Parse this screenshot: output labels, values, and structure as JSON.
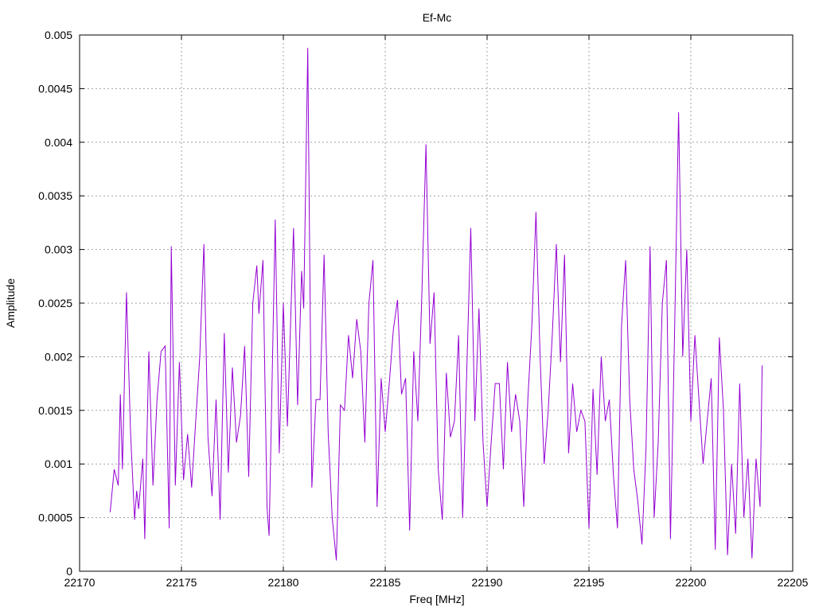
{
  "chart_data": {
    "type": "line",
    "title": "Ef-Mc",
    "xlabel": "Freq [MHz]",
    "ylabel": "Amplitude",
    "xlim": [
      22170,
      22205
    ],
    "ylim": [
      0,
      0.005
    ],
    "grid": true,
    "xticks": [
      22170,
      22175,
      22180,
      22185,
      22190,
      22195,
      22200,
      22205
    ],
    "xtick_labels": [
      "22170",
      "22175",
      "22180",
      "22185",
      "22190",
      "22195",
      "22200",
      "22205"
    ],
    "yticks": [
      0,
      0.0005,
      0.001,
      0.0015,
      0.002,
      0.0025,
      0.003,
      0.0035,
      0.004,
      0.0045,
      0.005
    ],
    "ytick_labels": [
      "0",
      "0.0005",
      "0.001",
      "0.0015",
      "0.002",
      "0.0025",
      "0.003",
      "0.0035",
      "0.004",
      "0.0045",
      "0.005"
    ],
    "colors": {
      "series": "#9400d3",
      "grid": "#a0a0a0"
    },
    "series": [
      {
        "points": [
          [
            22171.5,
            0.00055
          ],
          [
            22171.7,
            0.00095
          ],
          [
            22171.9,
            0.0008
          ],
          [
            22172.0,
            0.00165
          ],
          [
            22172.1,
            0.00095
          ],
          [
            22172.3,
            0.0026
          ],
          [
            22172.5,
            0.0013
          ],
          [
            22172.7,
            0.00048
          ],
          [
            22172.8,
            0.00075
          ],
          [
            22172.9,
            0.00058
          ],
          [
            22173.1,
            0.00105
          ],
          [
            22173.2,
            0.0003
          ],
          [
            22173.4,
            0.00205
          ],
          [
            22173.6,
            0.0008
          ],
          [
            22173.8,
            0.0016
          ],
          [
            22174.0,
            0.00205
          ],
          [
            22174.2,
            0.0021
          ],
          [
            22174.4,
            0.0004
          ],
          [
            22174.5,
            0.00303
          ],
          [
            22174.7,
            0.0008
          ],
          [
            22174.9,
            0.00195
          ],
          [
            22175.1,
            0.00085
          ],
          [
            22175.3,
            0.00128
          ],
          [
            22175.5,
            0.00078
          ],
          [
            22175.7,
            0.0014
          ],
          [
            22175.9,
            0.002
          ],
          [
            22176.1,
            0.00305
          ],
          [
            22176.3,
            0.00125
          ],
          [
            22176.5,
            0.0007
          ],
          [
            22176.7,
            0.0016
          ],
          [
            22176.9,
            0.00048
          ],
          [
            22177.1,
            0.00222
          ],
          [
            22177.3,
            0.00092
          ],
          [
            22177.5,
            0.0019
          ],
          [
            22177.7,
            0.0012
          ],
          [
            22177.9,
            0.00145
          ],
          [
            22178.1,
            0.0021
          ],
          [
            22178.3,
            0.00088
          ],
          [
            22178.5,
            0.0025
          ],
          [
            22178.7,
            0.00285
          ],
          [
            22178.8,
            0.0024
          ],
          [
            22179.0,
            0.0029
          ],
          [
            22179.2,
            0.0006
          ],
          [
            22179.3,
            0.00033
          ],
          [
            22179.6,
            0.00328
          ],
          [
            22179.8,
            0.0011
          ],
          [
            22180.0,
            0.0025
          ],
          [
            22180.2,
            0.00135
          ],
          [
            22180.5,
            0.0032
          ],
          [
            22180.7,
            0.00155
          ],
          [
            22180.9,
            0.0028
          ],
          [
            22181.0,
            0.00245
          ],
          [
            22181.2,
            0.00488
          ],
          [
            22181.4,
            0.00078
          ],
          [
            22181.6,
            0.0016
          ],
          [
            22181.8,
            0.0016
          ],
          [
            22182.0,
            0.00295
          ],
          [
            22182.2,
            0.0013
          ],
          [
            22182.4,
            0.0005
          ],
          [
            22182.6,
            0.0001
          ],
          [
            22182.8,
            0.00155
          ],
          [
            22183.0,
            0.0015
          ],
          [
            22183.2,
            0.0022
          ],
          [
            22183.4,
            0.0018
          ],
          [
            22183.6,
            0.00235
          ],
          [
            22183.8,
            0.00205
          ],
          [
            22184.0,
            0.0012
          ],
          [
            22184.2,
            0.0025
          ],
          [
            22184.4,
            0.0029
          ],
          [
            22184.6,
            0.0006
          ],
          [
            22184.8,
            0.0018
          ],
          [
            22185.0,
            0.0013
          ],
          [
            22185.2,
            0.00175
          ],
          [
            22185.4,
            0.00225
          ],
          [
            22185.6,
            0.00253
          ],
          [
            22185.8,
            0.00165
          ],
          [
            22186.0,
            0.0018
          ],
          [
            22186.2,
            0.00038
          ],
          [
            22186.4,
            0.00205
          ],
          [
            22186.6,
            0.0014
          ],
          [
            22186.8,
            0.0026
          ],
          [
            22187.0,
            0.00398
          ],
          [
            22187.2,
            0.00212
          ],
          [
            22187.4,
            0.0026
          ],
          [
            22187.6,
            0.00095
          ],
          [
            22187.8,
            0.00048
          ],
          [
            22188.0,
            0.00185
          ],
          [
            22188.2,
            0.00125
          ],
          [
            22188.4,
            0.0014
          ],
          [
            22188.6,
            0.0022
          ],
          [
            22188.8,
            0.0005
          ],
          [
            22189.0,
            0.00185
          ],
          [
            22189.2,
            0.0032
          ],
          [
            22189.4,
            0.0014
          ],
          [
            22189.6,
            0.00245
          ],
          [
            22189.8,
            0.0012
          ],
          [
            22190.0,
            0.0006
          ],
          [
            22190.2,
            0.0012
          ],
          [
            22190.4,
            0.00175
          ],
          [
            22190.6,
            0.00175
          ],
          [
            22190.8,
            0.00095
          ],
          [
            22191.0,
            0.00195
          ],
          [
            22191.2,
            0.0013
          ],
          [
            22191.4,
            0.00165
          ],
          [
            22191.6,
            0.0014
          ],
          [
            22191.8,
            0.0006
          ],
          [
            22192.0,
            0.0016
          ],
          [
            22192.2,
            0.0023
          ],
          [
            22192.4,
            0.00335
          ],
          [
            22192.6,
            0.002
          ],
          [
            22192.8,
            0.001
          ],
          [
            22193.0,
            0.0015
          ],
          [
            22193.2,
            0.0022
          ],
          [
            22193.4,
            0.00305
          ],
          [
            22193.6,
            0.00195
          ],
          [
            22193.8,
            0.00295
          ],
          [
            22194.0,
            0.0011
          ],
          [
            22194.2,
            0.00175
          ],
          [
            22194.4,
            0.0013
          ],
          [
            22194.6,
            0.0015
          ],
          [
            22194.8,
            0.0014
          ],
          [
            22195.0,
            0.0004
          ],
          [
            22195.2,
            0.0017
          ],
          [
            22195.4,
            0.0009
          ],
          [
            22195.6,
            0.002
          ],
          [
            22195.8,
            0.0014
          ],
          [
            22196.0,
            0.0016
          ],
          [
            22196.2,
            0.0009
          ],
          [
            22196.4,
            0.0004
          ],
          [
            22196.6,
            0.0023
          ],
          [
            22196.8,
            0.0029
          ],
          [
            22197.0,
            0.0016
          ],
          [
            22197.2,
            0.00095
          ],
          [
            22197.4,
            0.00065
          ],
          [
            22197.6,
            0.00025
          ],
          [
            22197.8,
            0.00115
          ],
          [
            22198.0,
            0.00303
          ],
          [
            22198.2,
            0.0005
          ],
          [
            22198.4,
            0.0012
          ],
          [
            22198.6,
            0.0025
          ],
          [
            22198.8,
            0.0029
          ],
          [
            22199.0,
            0.0003
          ],
          [
            22199.2,
            0.0022
          ],
          [
            22199.4,
            0.00428
          ],
          [
            22199.6,
            0.002
          ],
          [
            22199.8,
            0.003
          ],
          [
            22200.0,
            0.0014
          ],
          [
            22200.2,
            0.0022
          ],
          [
            22200.4,
            0.0016
          ],
          [
            22200.6,
            0.001
          ],
          [
            22200.8,
            0.0014
          ],
          [
            22201.0,
            0.0018
          ],
          [
            22201.2,
            0.0002
          ],
          [
            22201.4,
            0.00218
          ],
          [
            22201.6,
            0.0015
          ],
          [
            22201.8,
            0.00015
          ],
          [
            22202.0,
            0.001
          ],
          [
            22202.2,
            0.00035
          ],
          [
            22202.4,
            0.00175
          ],
          [
            22202.6,
            0.0005
          ],
          [
            22202.8,
            0.00105
          ],
          [
            22203.0,
            0.00012
          ],
          [
            22203.2,
            0.00105
          ],
          [
            22203.4,
            0.0006
          ],
          [
            22203.5,
            0.00192
          ]
        ]
      }
    ]
  }
}
